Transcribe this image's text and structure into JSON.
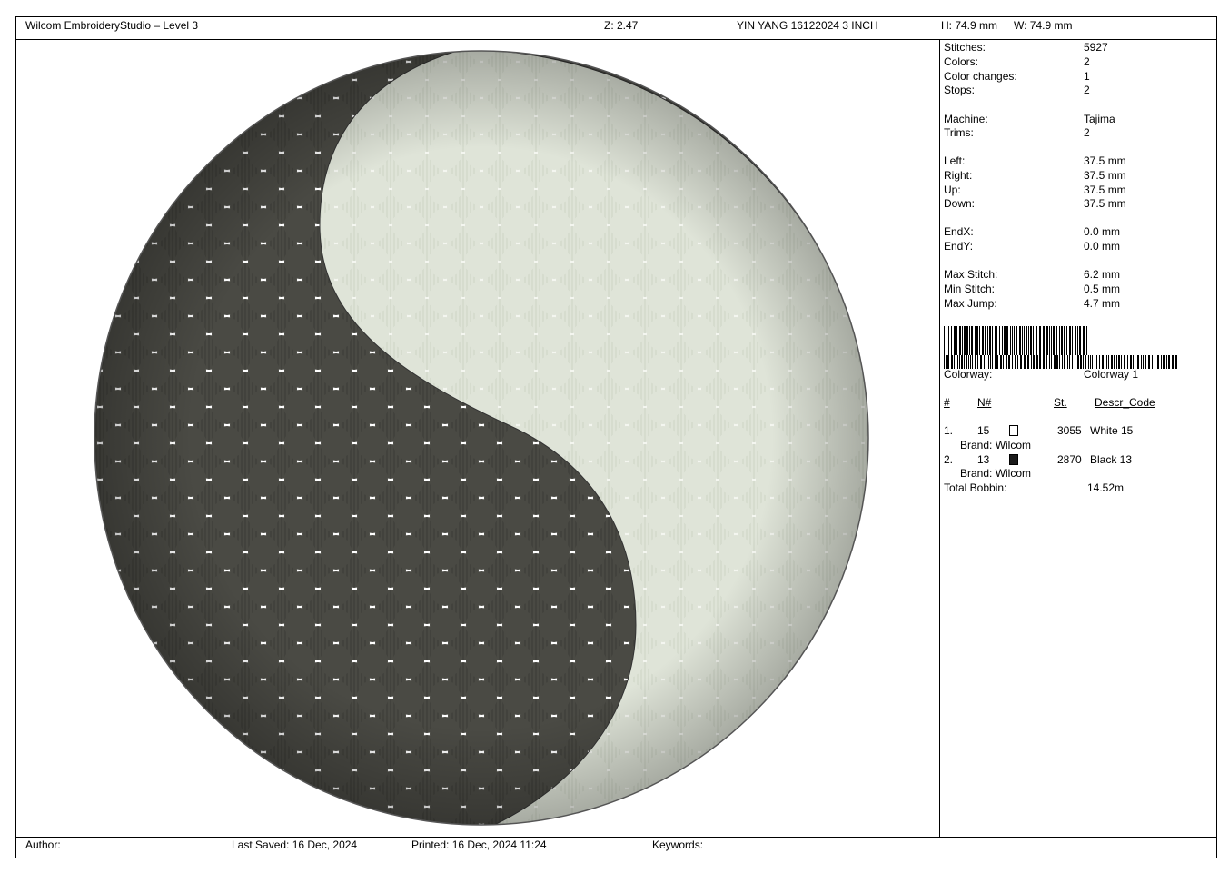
{
  "header": {
    "app_title": "Wilcom EmbroideryStudio – Level 3",
    "zoom": "Z: 2.47",
    "design_name": "YIN YANG 16122024 3 INCH",
    "height": "H: 74.9 mm",
    "width": "W: 74.9 mm"
  },
  "stats": {
    "stitches_label": "Stitches:",
    "stitches": "5927",
    "colors_label": "Colors:",
    "colors": "2",
    "color_changes_label": "Color changes:",
    "color_changes": "1",
    "stops_label": "Stops:",
    "stops": "2",
    "machine_label": "Machine:",
    "machine": "Tajima",
    "trims_label": "Trims:",
    "trims": "2",
    "left_label": "Left:",
    "left": "37.5 mm",
    "right_label": "Right:",
    "right": "37.5 mm",
    "up_label": "Up:",
    "up": "37.5 mm",
    "down_label": "Down:",
    "down": "37.5 mm",
    "endx_label": "EndX:",
    "endx": "0.0 mm",
    "endy_label": "EndY:",
    "endy": "0.0 mm",
    "max_stitch_label": "Max Stitch:",
    "max_stitch": "6.2 mm",
    "min_stitch_label": "Min Stitch:",
    "min_stitch": "0.5 mm",
    "max_jump_label": "Max Jump:",
    "max_jump": "4.7 mm",
    "colorway_label": "Colorway:",
    "colorway": "Colorway 1"
  },
  "color_table": {
    "headers": {
      "num": "#",
      "n": "N#",
      "st": "St.",
      "descr": "Descr_Code"
    },
    "rows": [
      {
        "index": "1.",
        "n": "15",
        "swatch": "#ffffff",
        "st": "3055",
        "descr": "White 15",
        "brand": "Brand: Wilcom"
      },
      {
        "index": "2.",
        "n": "13",
        "swatch": "#1a1a1a",
        "st": "2870",
        "descr": "Black 13",
        "brand": "Brand: Wilcom"
      }
    ],
    "total_bobbin_label": "Total Bobbin:",
    "total_bobbin": "14.52m"
  },
  "footer": {
    "author": "Author:",
    "last_saved": "Last Saved: 16 Dec, 2024",
    "printed": "Printed: 16 Dec, 2024 11:24",
    "keywords": "Keywords:"
  },
  "design_colors": {
    "dark": "#4a4a44",
    "light": "#e4e8de"
  }
}
